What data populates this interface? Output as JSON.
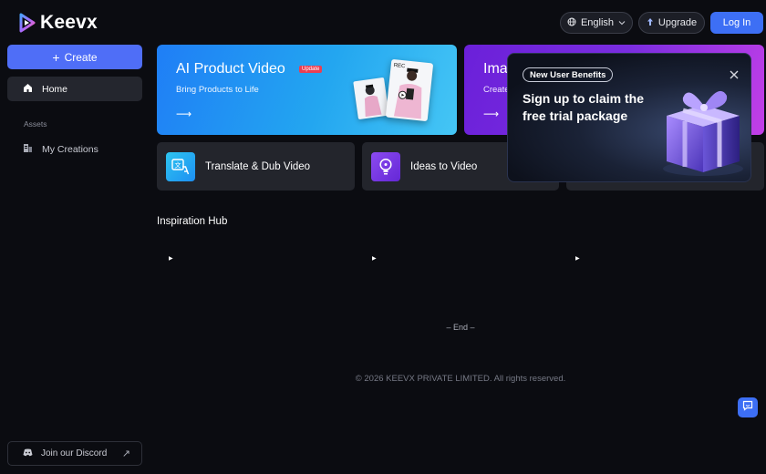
{
  "header": {
    "logo_text": "Keevx",
    "language_label": "English",
    "upgrade_label": "Upgrade",
    "login_label": "Log In"
  },
  "sidebar": {
    "create_label": "Create",
    "home_label": "Home",
    "assets_section": "Assets",
    "my_creations_label": "My Creations",
    "discord_label": "Join our Discord"
  },
  "banners": [
    {
      "title": "AI Product Video",
      "badge": "Update",
      "subtitle": "Bring Products to Life",
      "photo_tag": "REC"
    },
    {
      "title": "Ima",
      "subtitle": "Create"
    }
  ],
  "features": [
    {
      "label": "Translate & Dub Video",
      "icon": "translate-icon"
    },
    {
      "label": "Ideas to Video",
      "icon": "lightbulb-icon"
    },
    {
      "label": "",
      "icon": ""
    }
  ],
  "inspiration": {
    "title": "Inspiration Hub"
  },
  "footer": {
    "end_text": "– End –",
    "copyright": "© 2026 KEEVX PRIVATE LIMITED. All rights reserved."
  },
  "popup": {
    "pill": "New User Benefits",
    "headline": "Sign up to claim the free trial package"
  },
  "colors": {
    "accent": "#3d6ff5",
    "create": "#4f6ef7",
    "banner_blue": "#1f7ef6",
    "banner_purple": "#6b20d9",
    "badge_red": "#ea3f52"
  }
}
